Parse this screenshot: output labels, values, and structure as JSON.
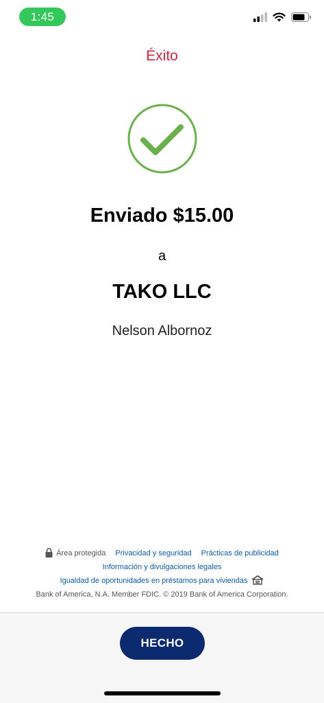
{
  "status_bar": {
    "time": "1:45",
    "icons": [
      "signal-icon",
      "wifi-icon",
      "battery-icon"
    ]
  },
  "header": {
    "title": "Éxito"
  },
  "success": {
    "icon": "check-circle-icon",
    "amount_text": "Enviado $15.00",
    "to_word": "a",
    "recipient": "TAKO LLC",
    "contact_name": "Nelson Albornoz"
  },
  "footer": {
    "secure_area": "Área protegida",
    "links": {
      "privacy": "Privacidad y seguridad",
      "advertising": "Prácticas de publicidad",
      "legal": "Información y divulgaciones legales",
      "equal_housing": "Igualdad de oportunidades en préstamos para viviendas"
    },
    "copyright": "Bank of America, N.A. Member FDIC. © 2019 Bank of America Corporation."
  },
  "actions": {
    "done_label": "HECHO"
  },
  "colors": {
    "title_red": "#d0223d",
    "check_green": "#6ab04c",
    "button_navy": "#0b2a6f",
    "link_blue": "#0b5aa4",
    "status_green": "#34c759"
  }
}
